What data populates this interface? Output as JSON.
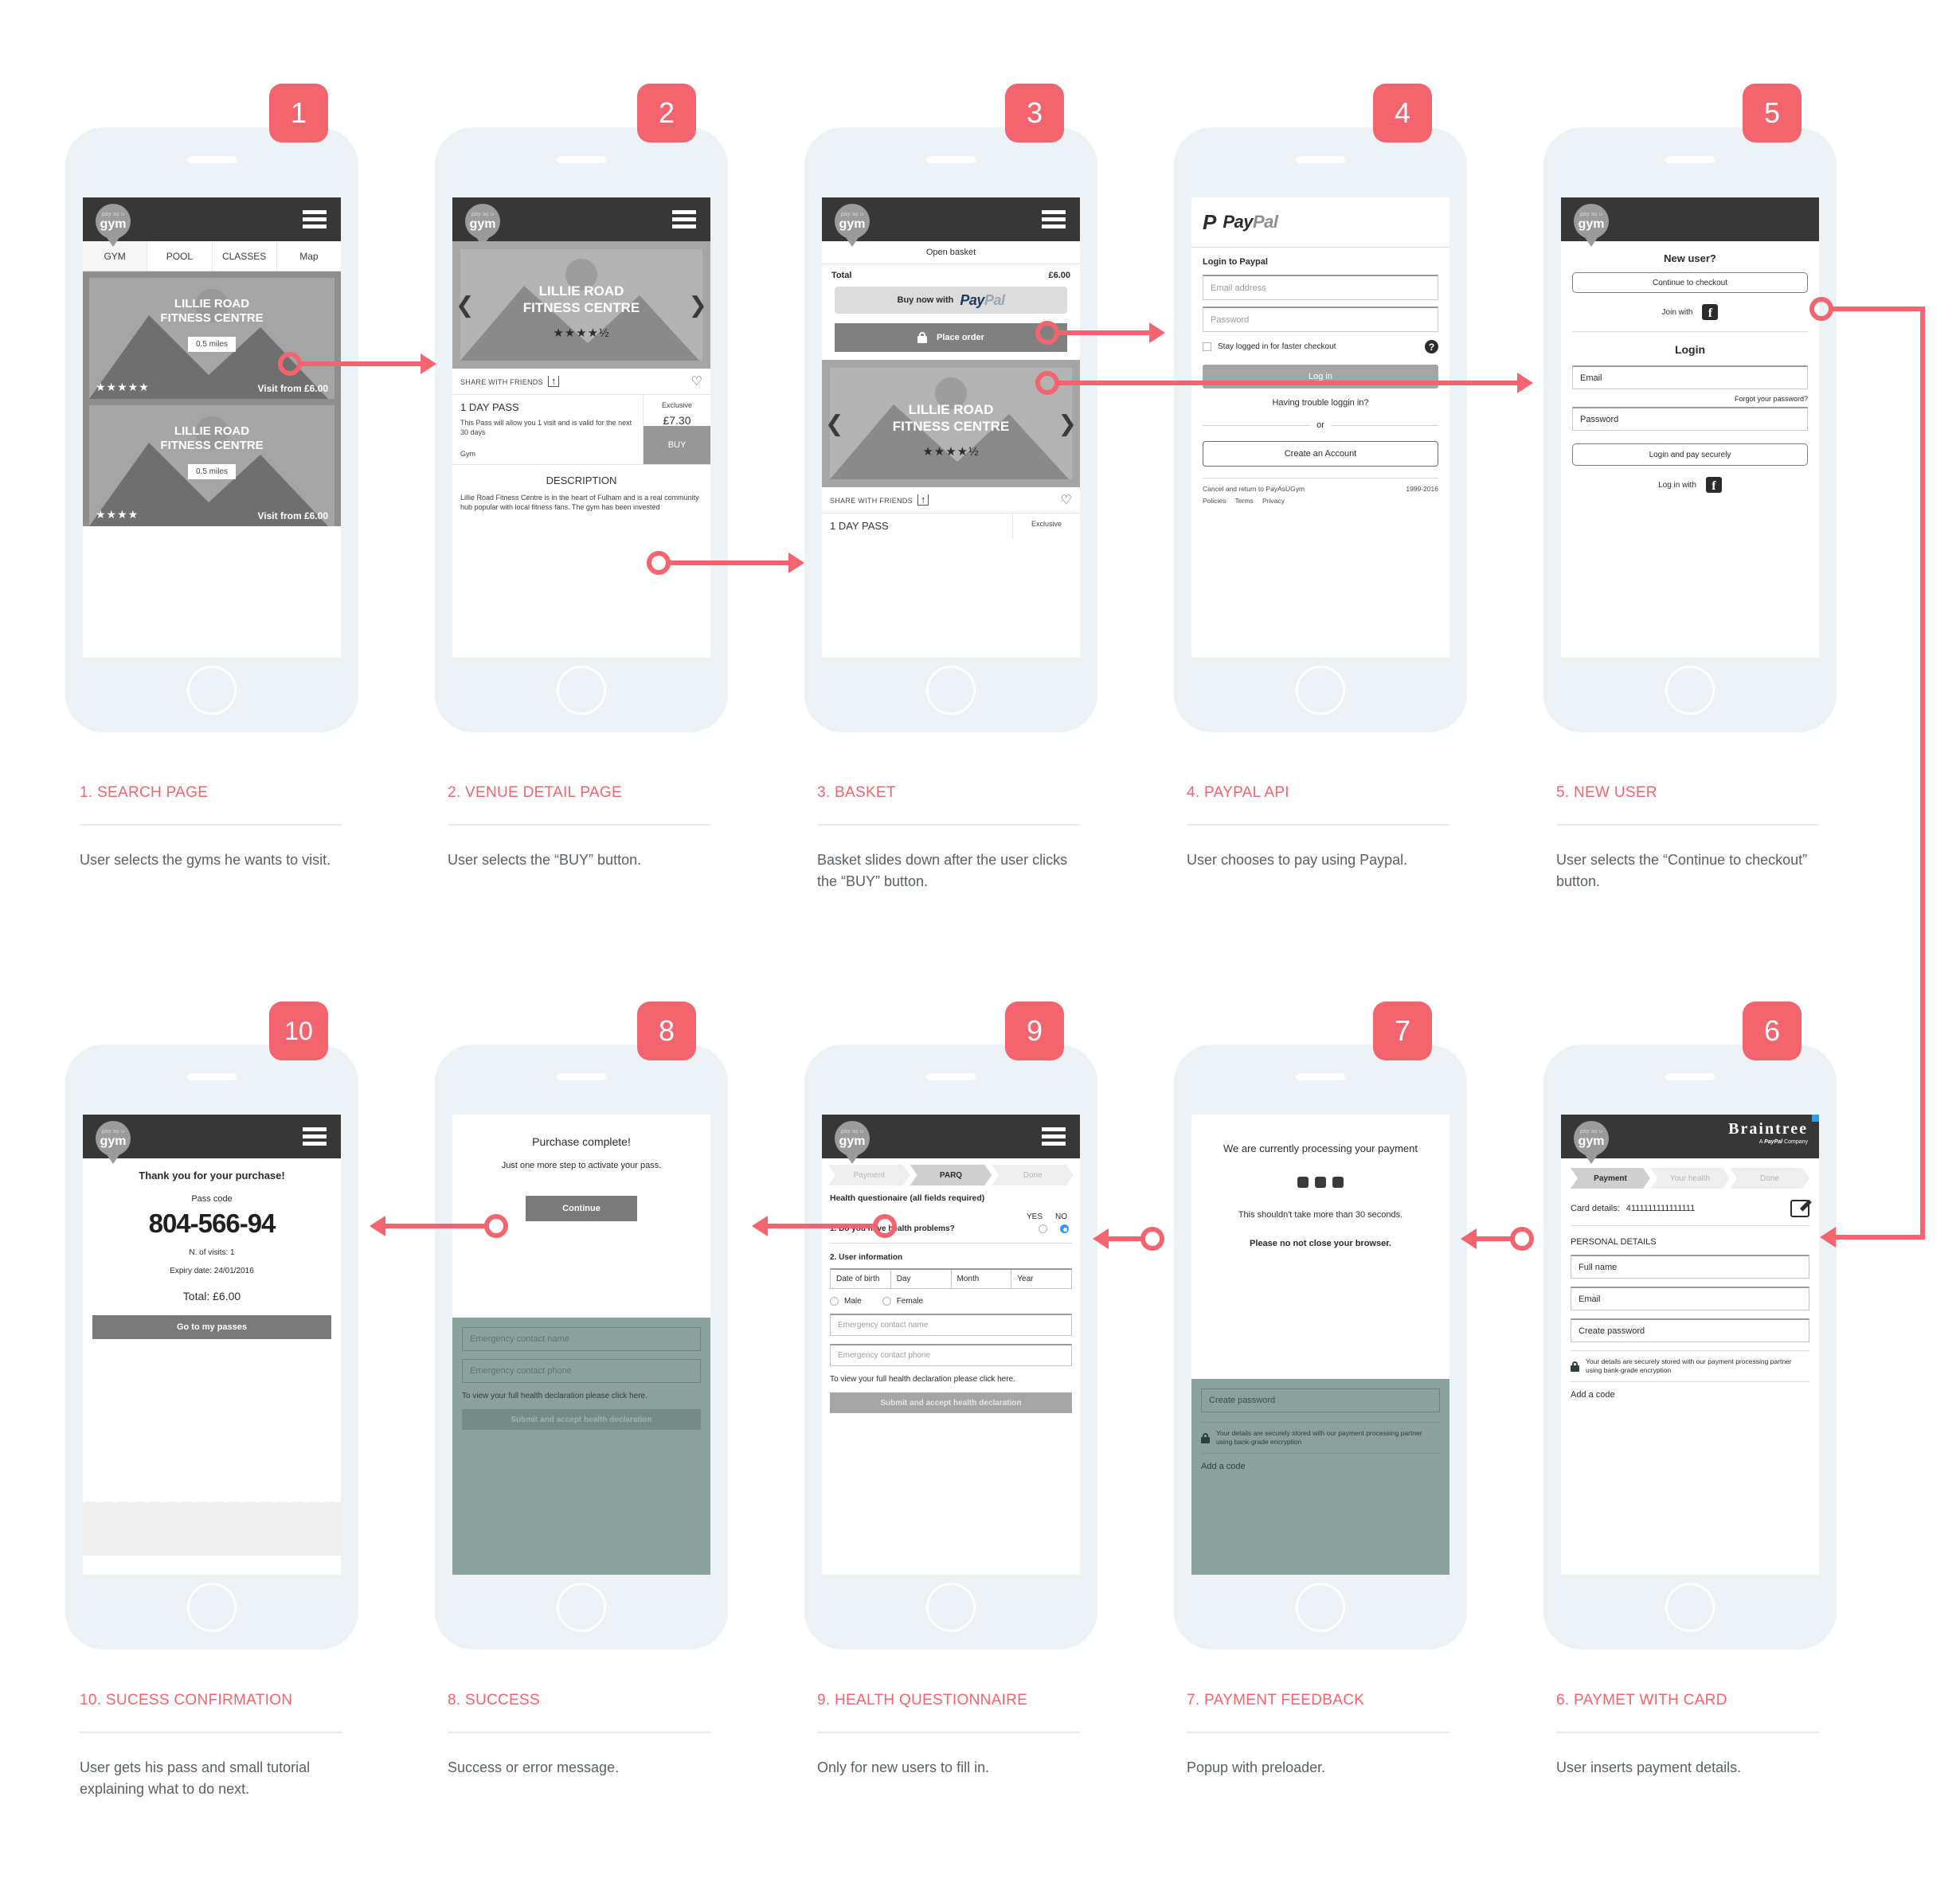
{
  "brand": {
    "logo_line1": "pay as u",
    "logo_line2": "gym",
    "accent": "#f4646e",
    "dark": "#373737"
  },
  "steps": [
    {
      "number": "1",
      "title": "1. SEARCH PAGE",
      "description": "User selects the gyms he wants to visit."
    },
    {
      "number": "2",
      "title": "2. VENUE DETAIL PAGE",
      "description": "User selects the “BUY” button."
    },
    {
      "number": "3",
      "title": "3. BASKET",
      "description": "Basket slides down after the user clicks the “BUY” button."
    },
    {
      "number": "4",
      "title": "4. PAYPAL API",
      "description": "User chooses to pay using Paypal."
    },
    {
      "number": "5",
      "title": "5. NEW USER",
      "description": "User selects the “Continue to checkout” button."
    },
    {
      "number": "10",
      "title": "10. SUCESS CONFIRMATION",
      "description": "User gets his pass and small tutorial explaining what to do next."
    },
    {
      "number": "8",
      "title": "8. SUCCESS",
      "description": "Success or error message."
    },
    {
      "number": "9",
      "title": "9. HEALTH QUESTIONNAIRE",
      "description": "Only for new users to fill in."
    },
    {
      "number": "7",
      "title": "7. PAYMENT FEEDBACK",
      "description": "Popup with preloader."
    },
    {
      "number": "6",
      "title": "6. PAYMET WITH CARD",
      "description": "User inserts payment details."
    }
  ],
  "search_page": {
    "tabs": [
      "GYM",
      "POOL",
      "CLASSES",
      "Map"
    ],
    "active_tab": "GYM",
    "cards": [
      {
        "title_line1": "LILLIE ROAD",
        "title_line2": "FITNESS CENTRE",
        "distance": "0.5 miles",
        "stars": "★★★★★",
        "price": "Visit from £6.00"
      },
      {
        "title_line1": "LILLIE ROAD",
        "title_line2": "FITNESS CENTRE",
        "distance": "0.5 miles",
        "stars": "★★★★",
        "price": "Visit from £6.00"
      }
    ]
  },
  "venue_page": {
    "hero_title_line1": "LILLIE ROAD",
    "hero_title_line2": "FITNESS CENTRE",
    "hero_rating": "★★★★½",
    "share_label": "SHARE WITH FRIENDS",
    "pass_title": "1 DAY PASS",
    "pass_desc": "This Pass will allow you 1 visit and is valid for the next 30 days",
    "pass_type": "Gym",
    "exclusive_label": "Exclusive",
    "price": "£7.30",
    "buy_label": "BUY",
    "description_heading": "DESCRIPTION",
    "description_body": "Lillie Road Fitness Centre is in the heart of Fulham and is a real community hub popular with local fitness fans. The gym has been invested"
  },
  "basket": {
    "open_basket_label": "Open basket",
    "total_label": "Total",
    "total_value": "£6.00",
    "paypal_button_label": "Buy now with",
    "paypal_logo_a": "Pay",
    "paypal_logo_b": "Pal",
    "place_order_label": "Place order",
    "hero_title_line1": "LILLIE ROAD",
    "hero_title_line2": "FITNESS CENTRE",
    "hero_rating": "★★★★½",
    "share_label": "SHARE WITH FRIENDS",
    "pass_title": "1 DAY PASS",
    "exclusive_label": "Exclusive"
  },
  "paypal": {
    "logo_a": "Pay",
    "logo_b": "Pal",
    "heading": "Login to Paypal",
    "email_placeholder": "Email address",
    "password_placeholder": "Password",
    "stay_logged_label": "Stay logged in for faster checkout",
    "help_icon_label": "?",
    "login_button": "Log in",
    "trouble_link": "Having trouble loggin in?",
    "or_label": "or",
    "create_account_button": "Create an Account",
    "cancel_link": "Cancel and return to PayAsUGym",
    "copyright": "1999-2016",
    "footer_links": [
      "Policies",
      "Terms",
      "Privacy"
    ]
  },
  "new_user": {
    "heading": "New user?",
    "continue_button": "Continue to checkout",
    "join_with_label": "Join with",
    "login_heading": "Login",
    "email_value": "Email",
    "forgot_link": "Forgot your password?",
    "password_value": "Password",
    "login_button": "Login and pay securely",
    "login_with_label": "Log in with"
  },
  "card_payment": {
    "braintree_name": "Braintree",
    "braintree_sub_a": "A ",
    "braintree_sub_b": "PayPal",
    "braintree_sub_c": " Company",
    "wizard": [
      "Payment",
      "Your health",
      "Done"
    ],
    "wizard_active": "Payment",
    "card_details_label": "Card details:",
    "card_number": "4111111111111111",
    "personal_details_heading": "PERSONAL DETAILS",
    "full_name_value": "Full name",
    "email_value": "Email",
    "create_password_value": "Create password",
    "secure_note": "Your details are securely stored with our payment processing partner using bank-grade encryption",
    "add_code_label": "Add a code"
  },
  "payment_feedback": {
    "heading": "We are currently processing your payment",
    "subtext": "This shouldn't take more than 30 seconds.",
    "bold_text": "Please no not close your browser.",
    "create_password_value": "Create password",
    "secure_note": "Your details are securely stored with our payment processing partner using bank-grade encryption",
    "add_code_label": "Add a code"
  },
  "health_questionnaire": {
    "wizard": [
      "Payment",
      "PARQ",
      "Done"
    ],
    "wizard_active": "PARQ",
    "heading": "Health questionaire (all fields required)",
    "yes_label": "YES",
    "no_label": "NO",
    "q1_label": "1. Do you have health problems?",
    "q1_answer": "NO",
    "section2_label": "2. User information",
    "dob_label": "Date of birth",
    "dob_day": "Day",
    "dob_month": "Month",
    "dob_year": "Year",
    "male_label": "Male",
    "female_label": "Female",
    "emergency_name_placeholder": "Emergency contact name",
    "emergency_phone_placeholder": "Emergency contact phone",
    "declaration_note": "To view your full health declaration please click here.",
    "submit_label": "Submit and accept health declaration"
  },
  "success": {
    "heading": "Purchase complete!",
    "subtext": "Just one more step to activate your pass.",
    "continue_button": "Continue",
    "emergency_name_placeholder": "Emergency contact name",
    "emergency_phone_placeholder": "Emergency contact phone",
    "declaration_note": "To view your full health declaration please click here.",
    "submit_label": "Submit and accept health declaration"
  },
  "success_confirmation": {
    "heading": "Thank you for your purchase!",
    "pass_code_label": "Pass code",
    "pass_code": "804-566-94",
    "visits": "N. of visits: 1",
    "expiry": "Expiry date: 24/01/2016",
    "total": "Total: £6.00",
    "button_label": "Go to my passes"
  }
}
